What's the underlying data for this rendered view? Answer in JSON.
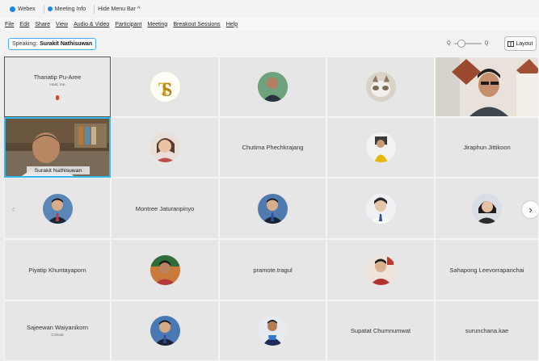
{
  "topbar": {
    "app": "Webex",
    "meeting_info": "Meeting Info",
    "hide_menu": "Hide Menu Bar ^"
  },
  "menus": [
    "File",
    "Edit",
    "Share",
    "View",
    "Audio & Video",
    "Participant",
    "Meeting",
    "Breakout Sessions",
    "Help"
  ],
  "speaking": {
    "label": "Speaking:",
    "name": "Surakit Nathisuwan"
  },
  "controls": {
    "zoom_out": "Q",
    "zoom_in": "Q",
    "layout": "Layout"
  },
  "tiles": [
    {
      "name": "Thanatip Pu-Aree",
      "sub": "Host, me"
    },
    {
      "name": "",
      "sub": ""
    },
    {
      "name": "",
      "sub": ""
    },
    {
      "name": "",
      "sub": ""
    },
    {
      "name": "",
      "sub": ""
    },
    {
      "name": "Surakit Nathisuwan",
      "sub": ""
    },
    {
      "name": "",
      "sub": ""
    },
    {
      "name": "Chutima Phechkrajang",
      "sub": ""
    },
    {
      "name": "",
      "sub": ""
    },
    {
      "name": "Jiraphun Jittikoon",
      "sub": ""
    },
    {
      "name": "",
      "sub": ""
    },
    {
      "name": "Montree Jaturanpinyo",
      "sub": ""
    },
    {
      "name": "",
      "sub": ""
    },
    {
      "name": "",
      "sub": ""
    },
    {
      "name": "",
      "sub": ""
    },
    {
      "name": "Piyatip Khuntayaporn",
      "sub": ""
    },
    {
      "name": "",
      "sub": ""
    },
    {
      "name": "pramote.tragul",
      "sub": ""
    },
    {
      "name": "",
      "sub": ""
    },
    {
      "name": "Sahapong Leevorrapanchai",
      "sub": ""
    },
    {
      "name": "Sajeewan Waiyanikorn",
      "sub": "Cohost"
    },
    {
      "name": "",
      "sub": ""
    },
    {
      "name": "",
      "sub": ""
    },
    {
      "name": "Supatat Chumnumwat",
      "sub": ""
    },
    {
      "name": "surunchana.kae",
      "sub": ""
    }
  ],
  "colors": {
    "accent": "#1d86e0",
    "speaking_border": "#34b8f0",
    "tile_bg": "#e6e6e6"
  },
  "nav": {
    "prev_icon": "chevron-left-icon",
    "next_icon": "chevron-right-icon"
  }
}
